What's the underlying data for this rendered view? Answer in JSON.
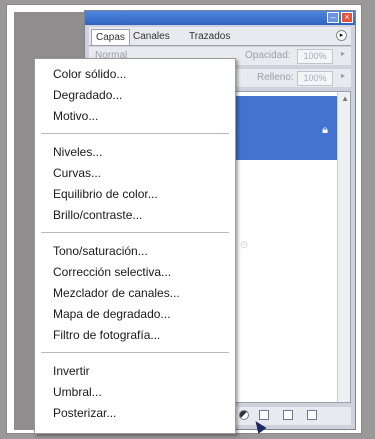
{
  "panel": {
    "tabs": [
      "Capas",
      "Canales",
      "Trazados"
    ],
    "blend_mode": "Normal",
    "opacity_label": "Opacidad:",
    "opacity_value": "100%",
    "fill_label": "Relleno:",
    "fill_value": "100%",
    "colors": {
      "accent": "#4472d1",
      "panel": "#cfd2da"
    }
  },
  "menu": {
    "group1": [
      "Color sólido...",
      "Degradado...",
      "Motivo..."
    ],
    "group2": [
      "Niveles...",
      "Curvas...",
      "Equilibrio de color...",
      "Brillo/contraste..."
    ],
    "group3": [
      "Tono/saturación...",
      "Corrección selectiva...",
      "Mezclador de canales...",
      "Mapa de degradado...",
      "Filtro de fotografía..."
    ],
    "group4": [
      "Invertir",
      "Umbral...",
      "Posterizar..."
    ]
  },
  "icons": [
    "lock-icon",
    "adjustment-layer-icon",
    "new-group-icon",
    "new-layer-icon",
    "trash-icon"
  ]
}
